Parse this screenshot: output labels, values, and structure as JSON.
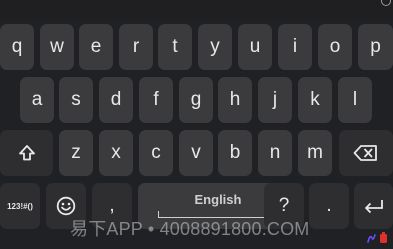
{
  "keyboard": {
    "row1": [
      "q",
      "w",
      "e",
      "r",
      "t",
      "y",
      "u",
      "i",
      "o",
      "p"
    ],
    "row2": [
      "a",
      "s",
      "d",
      "f",
      "g",
      "h",
      "j",
      "k",
      "l"
    ],
    "row3": [
      "z",
      "x",
      "c",
      "v",
      "b",
      "n",
      "m"
    ],
    "shift_icon": "shift-icon",
    "backspace_icon": "backspace-icon",
    "symbols_label": "123!#()",
    "emoji_icon": "emoji-icon",
    "comma": ",",
    "space_label": "English",
    "question": "?",
    "period": ".",
    "enter_icon": "enter-icon"
  },
  "watermark": "易下APP • 4008891800.COM",
  "colors": {
    "background": "#202124",
    "key": "#3b3b3d",
    "key_text": "#e8e8e8",
    "corner_purple": "#6a4cff",
    "corner_red": "#e0302a"
  }
}
